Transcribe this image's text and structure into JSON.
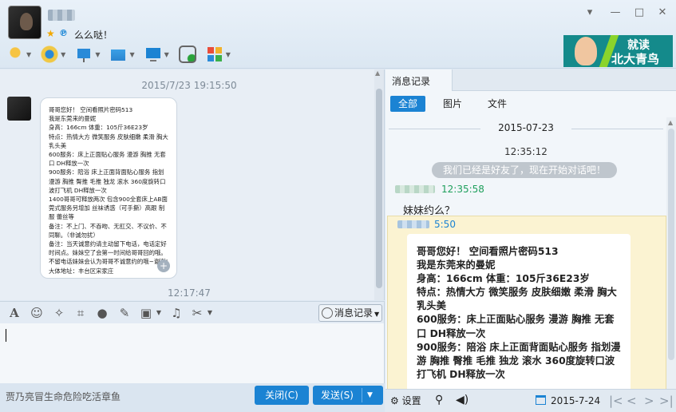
{
  "header": {
    "status_text": "么么哒！"
  },
  "ad": {
    "line1": "就读",
    "line2": "北大青鸟"
  },
  "chat": {
    "timestamp1": "2015/7/23 19:15:50",
    "timestamp2": "12:17:47",
    "image_text": "哥哥您好！ 空间看照片密码513\n我是东莞来的曼妮\n身高：166cm 体重：105斤36E23岁\n特点：热情大方 微笑服务 皮肤细嫩 柔滑 胸大乳头美\n600服务：床上正面贴心服务 漫游 胸推 无套口 DH释放一次\n900服务：陪浴 床上正面背面贴心服务 指划 漫游 胸推 臀推 毛推 独龙 滚水 360度旋转口 波打飞机 DH释放一次\n1400哥哥可释放两次 包含900全套床上AB面 莞式服务另增加 丝袜诱惑（可手撕）高跟 制服 蕾丝等\n备注：不上门、不吞吻、无肛交、不议价、不同聊。（非诚勿扰）\n备注：当天诚意约请主动留下电话，电话定好时间点。妹妹空了会第一时间给哥哥回的哦。不留电话妹妹会认为哥哥不诚意约的哦~谢谢!\n大体地址：丰台区宋家庄"
  },
  "input_toolbar": {
    "msg_record_label": "消息记录"
  },
  "bottom": {
    "note": "贾乃亮冒生命危险吃活章鱼",
    "close_label": "关闭(C)",
    "send_label": "发送(S)"
  },
  "history": {
    "tab_title": "消息记录",
    "filters": [
      "全部",
      "图片",
      "文件"
    ],
    "date_header": "2015-07-23",
    "time1": "12:35:12",
    "system_msg": "我们已经是好友了，现在开始对话吧！",
    "time2": "12:35:58",
    "msg1": "妹妹约么？",
    "time3": "5:50",
    "card_text": "哥哥您好！ 空间看照片密码513\n我是东莞来的曼妮\n身高：166cm 体重：105斤36E23岁\n特点：热情大方 微笑服务 皮肤细嫩 柔滑 胸大乳头美\n600服务：床上正面贴心服务 漫游 胸推 无套口 DH释放一次\n900服务：陪浴 床上正面背面贴心服务 指划漫游 胸推 臀推 毛推 独龙 滚水 360度旋转口波打飞机 DH释放一次",
    "settings_label": "设置",
    "current_date": "2015-7-24"
  }
}
